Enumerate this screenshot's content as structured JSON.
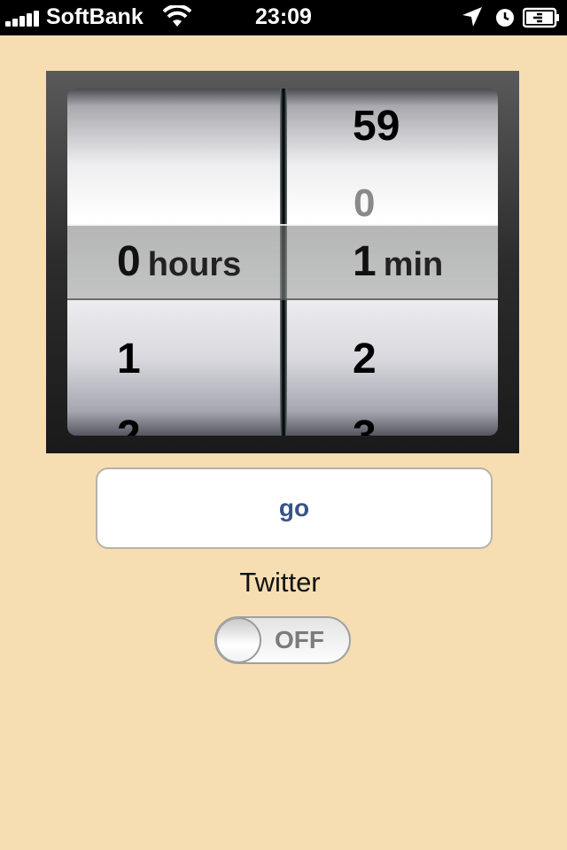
{
  "status_bar": {
    "carrier": "SoftBank",
    "time": "23:09",
    "signal_bars": 5,
    "icons": [
      "signal-bars-icon",
      "wifi-icon",
      "location-arrow-icon",
      "alarm-clock-icon",
      "battery-charging-icon"
    ]
  },
  "picker": {
    "hours": {
      "rows_above": [
        "",
        ""
      ],
      "selected_value": "0",
      "unit": "hours",
      "rows_below": [
        "1",
        "2"
      ]
    },
    "minutes": {
      "rows_above": [
        "59",
        "0"
      ],
      "selected_value": "1",
      "unit": "min",
      "rows_below": [
        "2",
        "3"
      ]
    }
  },
  "go_button": {
    "label": "go"
  },
  "twitter": {
    "label": "Twitter",
    "toggle_state": "OFF"
  },
  "colors": {
    "background": "#f6deb2",
    "button_text": "#385487"
  }
}
